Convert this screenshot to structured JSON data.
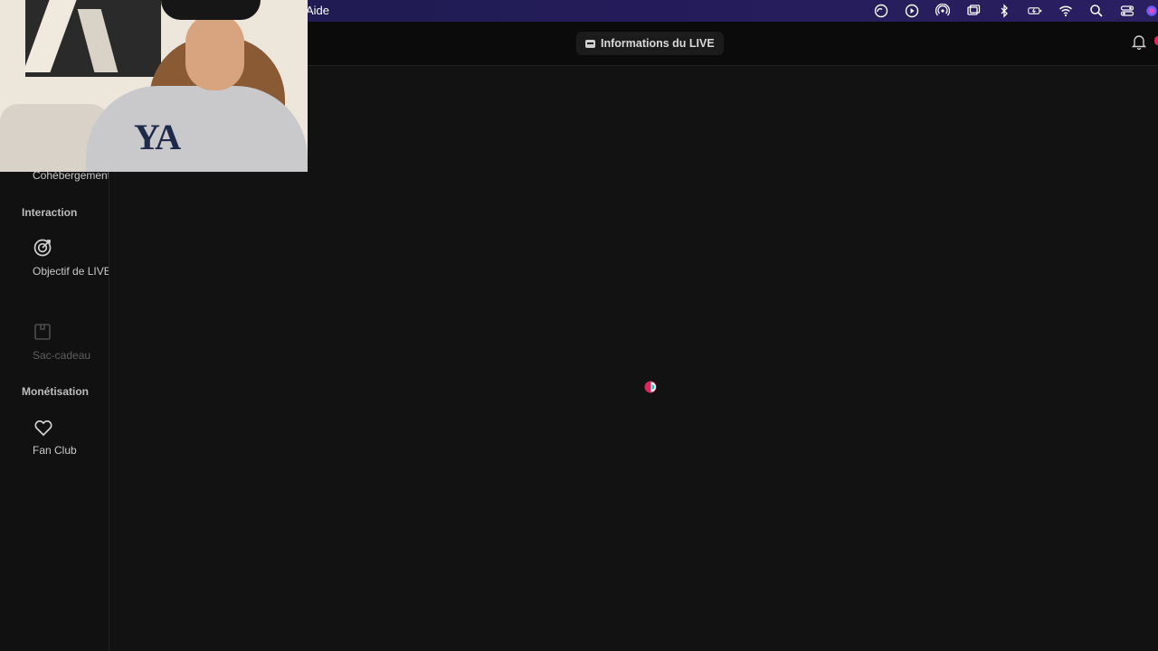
{
  "menubar": {
    "menu_item": "Aide",
    "status_icons": [
      "creative-cloud-icon",
      "play-circle-icon",
      "airdrop-icon",
      "screen-mirroring-icon",
      "bluetooth-icon",
      "battery-charging-icon",
      "wifi-icon",
      "spotlight-search-icon",
      "control-center-icon",
      "siri-icon"
    ]
  },
  "header": {
    "live_info_label": "Informations du LIVE",
    "notification_icon": "bell-icon"
  },
  "sidebar": {
    "partial_item_label": "Cohébergement",
    "sections": [
      {
        "title": "Interaction",
        "items": [
          {
            "label": "Objectif de LIVE",
            "icon": "target-icon",
            "enabled": true
          },
          {
            "label": "Sac-cadeau",
            "icon": "gift-bag-icon",
            "enabled": false
          }
        ]
      },
      {
        "title": "Monétisation",
        "items": [
          {
            "label": "Fan Club",
            "icon": "heart-icon",
            "enabled": true
          }
        ]
      }
    ]
  },
  "webcam": {
    "hoodie_text": "YA"
  },
  "colors": {
    "background": "#121212",
    "accent": "#e0245e",
    "spinner_secondary": "#25c2c6",
    "menubar": "#241c5a"
  }
}
